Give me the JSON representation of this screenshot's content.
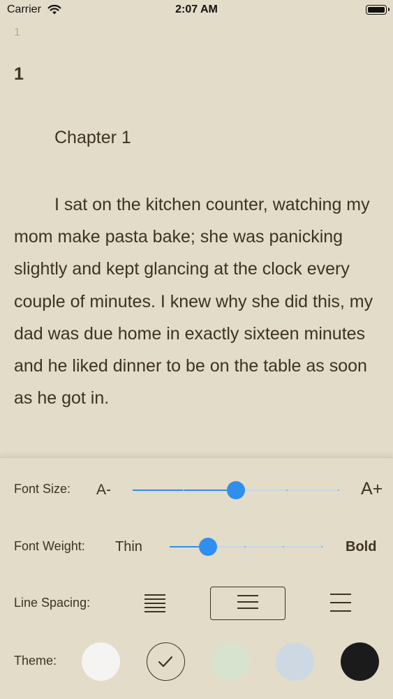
{
  "status_bar": {
    "carrier": "Carrier",
    "time": "2:07 AM"
  },
  "reader": {
    "page_number": "1",
    "chapter_number": "1",
    "chapter_title": "Chapter 1",
    "paragraph": "I sat on the kitchen counter, watching my mom make pasta bake; she was panicking slightly and kept glancing at the clock every couple of minutes. I knew why she did this, my dad was due home in exactly sixteen minutes and he liked dinner to be on the table as soon as he got in."
  },
  "settings": {
    "font_size": {
      "label": "Font Size:",
      "decrease_label": "A-",
      "increase_label": "A+",
      "value_fraction": 0.5
    },
    "font_weight": {
      "label": "Font Weight:",
      "min_label": "Thin",
      "max_label": "Bold",
      "value_fraction": 0.25
    },
    "line_spacing": {
      "label": "Line Spacing:",
      "options": [
        "compact",
        "normal",
        "wide"
      ],
      "selected": "normal"
    },
    "theme": {
      "label": "Theme:",
      "options": [
        {
          "name": "white",
          "color": "#f5f4f2"
        },
        {
          "name": "sepia",
          "color": "#e3dcc8",
          "selected": true
        },
        {
          "name": "green",
          "color": "#d8e3cf"
        },
        {
          "name": "blue",
          "color": "#cdd8e2"
        },
        {
          "name": "black",
          "color": "#1b1b1b"
        }
      ]
    },
    "accent_color": "#2f8fef"
  }
}
